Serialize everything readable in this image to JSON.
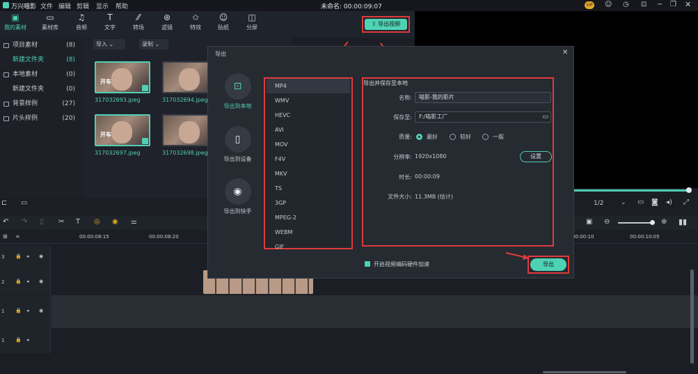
{
  "titlebar": {
    "app_name": "万兴喵影",
    "menus": [
      "文件",
      "编辑",
      "剪辑",
      "显示",
      "帮助"
    ],
    "project_title": "未命名: 00:00:09:07",
    "vip": "VIP"
  },
  "toolbar": {
    "tools": [
      "我的素材",
      "素材库",
      "音频",
      "文字",
      "转场",
      "滤镜",
      "特效",
      "贴纸",
      "分屏"
    ],
    "export_video": "导出视频"
  },
  "sidebar": {
    "items": [
      {
        "label": "项目素材",
        "count": "(8)"
      },
      {
        "label": "新建文件夹",
        "count": "(8)"
      },
      {
        "label": "本地素材",
        "count": "(0)"
      },
      {
        "label": "新建文件夹",
        "count": "(0)"
      },
      {
        "label": "背景样例",
        "count": "(27)"
      },
      {
        "label": "片头样例",
        "count": "(20)"
      }
    ]
  },
  "media": {
    "import": "导入",
    "record": "录制",
    "files": [
      {
        "name": "317032693.jpeg",
        "tag": "开车"
      },
      {
        "name": "317032694.jpeg",
        "tag": ""
      },
      {
        "name": "317032697.jpeg",
        "tag": "开车"
      },
      {
        "name": "317032698.jpeg",
        "tag": ""
      }
    ]
  },
  "preview": {
    "page": "1/2"
  },
  "timeline": {
    "ticks": [
      "00:00:08:15",
      "00:00:08:20",
      "00:00:10",
      "00:00:10:05"
    ],
    "tracks": [
      "3",
      "2",
      "1",
      "1"
    ]
  },
  "dialog": {
    "title": "导出",
    "nav": [
      {
        "label": "导出到本地"
      },
      {
        "label": "导出到设备"
      },
      {
        "label": "导出到快手"
      }
    ],
    "formats": [
      "MP4",
      "WMV",
      "HEVC",
      "AVI",
      "MOV",
      "F4V",
      "MKV",
      "TS",
      "3GP",
      "MPEG-2",
      "WEBM",
      "GIF"
    ],
    "settings_heading": "导出并保存至本地",
    "name_label": "名称:",
    "name_value": "喵影-我的影片",
    "save_label": "保存至:",
    "save_value": "F:/喵影工厂",
    "quality_label": "质量:",
    "quality_options": [
      "最好",
      "较好",
      "一般"
    ],
    "resolution_label": "分辨率:",
    "resolution_value": "1920x1080",
    "settings_button": "设置",
    "duration_label": "时长:",
    "duration_value": "00:00:09",
    "filesize_label": "文件大小:",
    "filesize_value": "11.3MB (估计)",
    "hw_accel": "开启视频编码硬件加速",
    "export_button": "导出"
  }
}
